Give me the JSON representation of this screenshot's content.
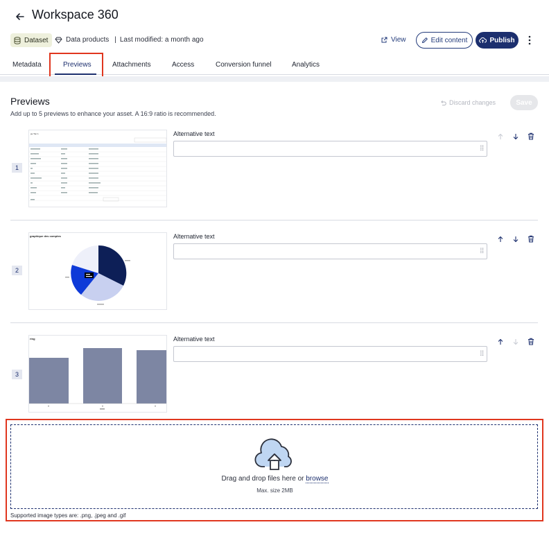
{
  "header": {
    "back_icon": "arrow-left-icon",
    "title": "Workspace 360",
    "badge_label": "Dataset",
    "badge_icon": "database-icon",
    "category": "Data products",
    "category_icon": "diamond-icon",
    "separator": "|",
    "last_modified": "Last modified: a month ago",
    "view_label": "View",
    "edit_label": "Edit content",
    "publish_label": "Publish",
    "more_icon": "more-vertical-icon"
  },
  "tabs": [
    {
      "label": "Metadata"
    },
    {
      "label": "Previews",
      "active": true
    },
    {
      "label": "Attachments"
    },
    {
      "label": "Access"
    },
    {
      "label": "Conversion funnel"
    },
    {
      "label": "Analytics"
    }
  ],
  "previews": {
    "title": "Previews",
    "subtitle": "Add up to 5 previews to enhance your asset. A 16:9 ratio is recommended.",
    "discard_label": "Discard changes",
    "save_label": "Save",
    "items": [
      {
        "number": "1",
        "alt_label": "Alternative text",
        "alt_value": "",
        "thumb_title": "pe Tier 1"
      },
      {
        "number": "2",
        "alt_label": "Alternative text",
        "alt_value": "",
        "thumb_title": "graphique des comptes"
      },
      {
        "number": "3",
        "alt_label": "Alternative text",
        "alt_value": "",
        "thumb_title": "ring"
      }
    ]
  },
  "upload": {
    "drag_text": "Drag and drop files here or",
    "browse_label": "browse",
    "max_size": "Max. size 2MB",
    "supported": "Supported image types are: .png, .jpeg and .gif",
    "icon": "cloud-upload-icon"
  },
  "colors": {
    "primary": "#1c2f6e",
    "highlight": "#e0361e",
    "badge_bg": "#eef0dc"
  }
}
